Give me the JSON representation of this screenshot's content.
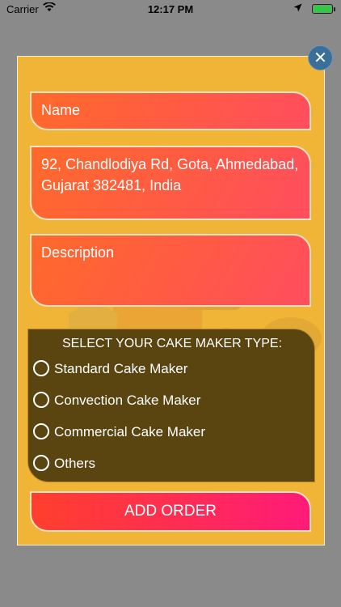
{
  "status_bar": {
    "carrier": "Carrier",
    "time": "12:17 PM"
  },
  "form": {
    "name_placeholder": "Name",
    "address_value": "92, Chandlodiya Rd, Gota, Ahmedabad, Gujarat 382481, India",
    "description_placeholder": "Description"
  },
  "cake_type": {
    "title": "SELECT YOUR CAKE MAKER TYPE:",
    "options": [
      "Standard Cake Maker",
      "Convection Cake Maker",
      "Commercial Cake Maker",
      "Others"
    ]
  },
  "actions": {
    "add_order": "ADD ORDER",
    "close_icon": "close-icon"
  },
  "colors": {
    "modal_bg": "#f0b537",
    "field_gradient_start": "#ff6a2a",
    "field_gradient_end": "#ff4d5f",
    "panel_bg": "#5a4511",
    "button_gradient_end": "#ff1a79"
  }
}
